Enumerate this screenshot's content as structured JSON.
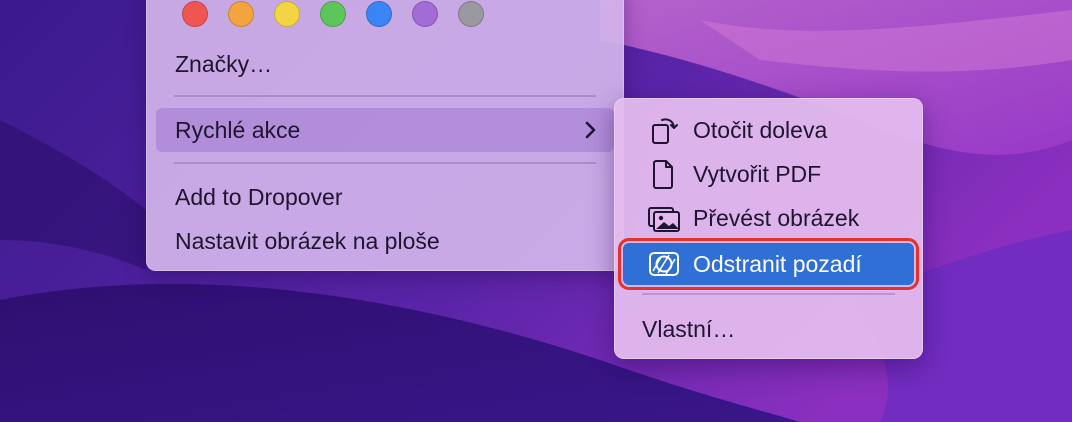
{
  "tags": {
    "colors": [
      "#ef5552",
      "#f3a43e",
      "#f3d442",
      "#5cc65a",
      "#3b84f5",
      "#a36bd6",
      "#9a98a0"
    ]
  },
  "context_menu": {
    "tags_label": "Značky…",
    "quick_actions_label": "Rychlé akce",
    "add_to_dropover_label": "Add to Dropover",
    "set_desktop_label": "Nastavit obrázek na ploše"
  },
  "quick_actions_submenu": {
    "items": [
      {
        "label": "Otočit doleva",
        "icon": "rotate-left-icon"
      },
      {
        "label": "Vytvořit PDF",
        "icon": "document-icon"
      },
      {
        "label": "Převést obrázek",
        "icon": "photos-icon"
      },
      {
        "label": "Odstranit pozadí",
        "icon": "remove-background-icon"
      }
    ],
    "custom_label": "Vlastní…"
  },
  "colors": {
    "selection": "#2f6fd6",
    "highlight_outline": "#e0332c"
  }
}
